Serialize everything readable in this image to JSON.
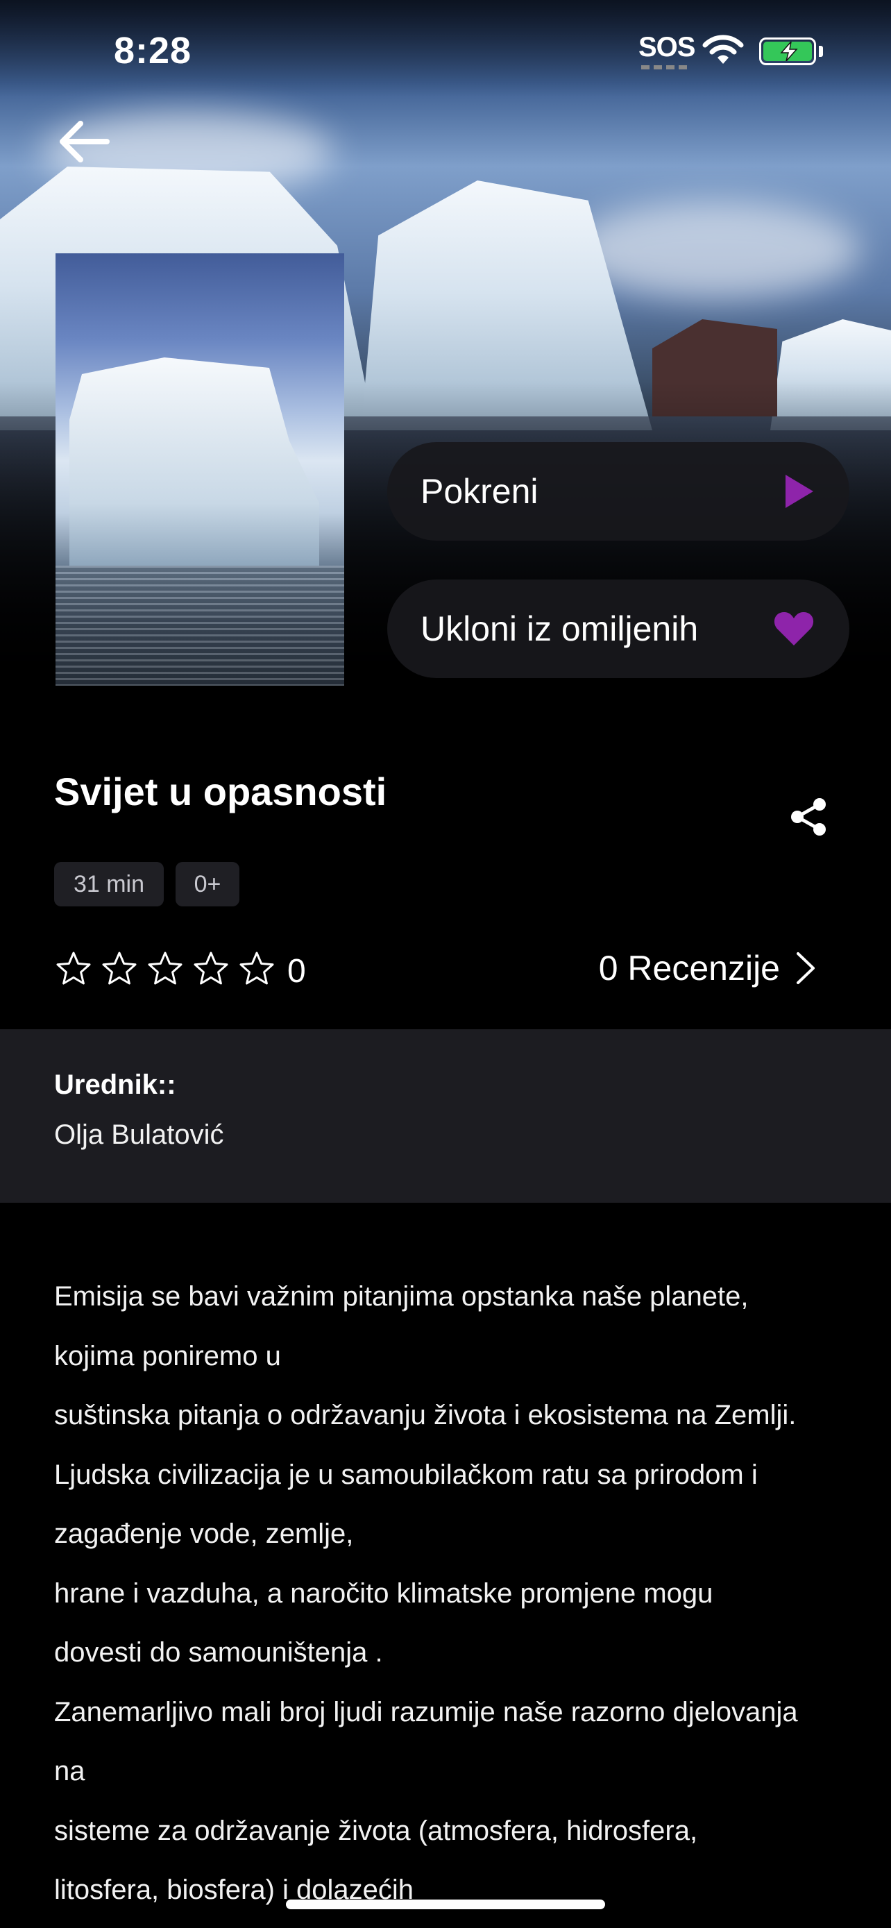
{
  "status_bar": {
    "time": "8:28",
    "sos": "SOS",
    "battery": "charging"
  },
  "header": {
    "back_icon": "arrow-left-icon"
  },
  "actions": {
    "play_label": "Pokreni",
    "play_icon": "play-icon",
    "favorite_label": "Ukloni iz omiljenih",
    "favorite_icon": "heart-icon"
  },
  "show": {
    "title": "Svijet u opasnosti",
    "duration": "31 min",
    "age_rating": "0+",
    "rating": {
      "stars_filled": 0,
      "stars_total": 5,
      "value": "0"
    },
    "reviews_label": "0 Recenzije"
  },
  "editor": {
    "label": "Urednik::",
    "name": "Olja Bulatović"
  },
  "description": [
    "Emisija se bavi važnim pitanjima opstanka naše planete,",
    "kojima poniremo u",
    "suštinska pitanja o održavanju života i ekosistema na Zemlji.",
    "Ljudska civilizacija je u samoubilačkom ratu sa prirodom i",
    "zagađenje vode, zemlje,",
    "hrane i vazduha, a naročito klimatske promjene mogu",
    "dovesti do samouništenja .",
    "Zanemarljivo mali broj ljudi razumije naše razorno djelovanja",
    "na",
    "sisteme za održavanje života (atmosfera, hidrosfera,",
    "litosfera, biosfera) i dolazećih"
  ],
  "colors": {
    "accent": "#8e24aa",
    "background": "#000000",
    "panel": "#1c1c21",
    "chip": "#1f1f24",
    "battery": "#34c759"
  }
}
